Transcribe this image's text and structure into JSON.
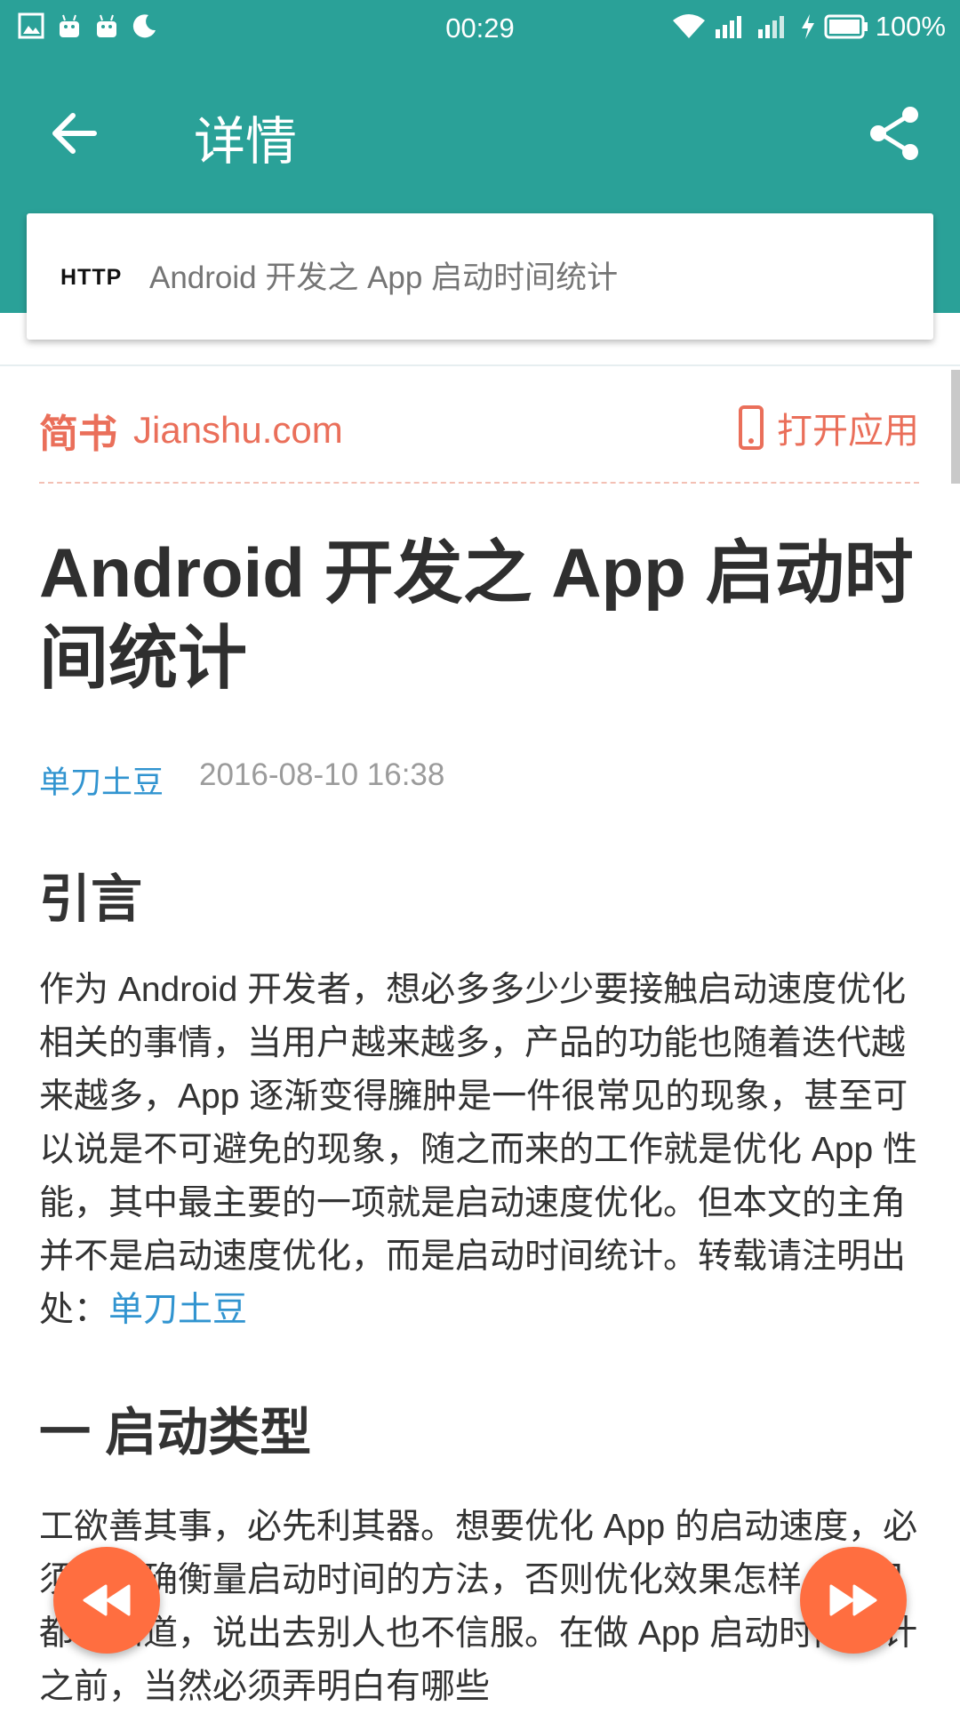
{
  "status_bar": {
    "time": "00:29",
    "battery": "100%",
    "left_icons": [
      "gallery-icon",
      "android-icon",
      "android-icon",
      "moon-icon"
    ],
    "right_icons": [
      "wifi-icon",
      "signal-icon",
      "signal-icon",
      "charging-icon",
      "battery-icon"
    ]
  },
  "appbar": {
    "title": "详情",
    "back_icon": "arrow-left-icon",
    "share_icon": "share-icon"
  },
  "url_card": {
    "protocol": "HTTP",
    "page_title": "Android 开发之 App 启动时间统计"
  },
  "site_header": {
    "logo_cn": "简书",
    "logo_domain": "Jianshu.com",
    "open_app_label": "打开应用"
  },
  "article": {
    "title": "Android 开发之 App 启动时间统计",
    "author": "单刀土豆",
    "date": "2016-08-10 16:38",
    "sections": [
      {
        "heading": "引言",
        "paragraph": "作为 Android 开发者，想必多多少少要接触启动速度优化相关的事情，当用户越来越多，产品的功能也随着迭代越来越多，App 逐渐变得臃肿是一件很常见的现象，甚至可以说是不可避免的现象，随之而来的工作就是优化 App 性能，其中最主要的一项就是启动速度优化。但本文的主角并不是启动速度优化，而是启动时间统计。转载请注明出处：",
        "link": "单刀土豆"
      },
      {
        "heading": "一 启动类型",
        "paragraph": "工欲善其事，必先利其器。想要优化 App 的启动速度，必须有准确衡量启动时间的方法，否则优化效果怎样，自己都不知道，说出去别人也不信服。在做 App 启动时间统计之前，当然必须弄明白有哪些"
      }
    ]
  },
  "fabs": {
    "left_icon": "rewind-icon",
    "right_icon": "fast-forward-icon"
  },
  "colors": {
    "primary": "#2aa198",
    "jianshu_accent": "#ea6f5a",
    "link": "#3194d0",
    "fab": "#ff6e40"
  }
}
